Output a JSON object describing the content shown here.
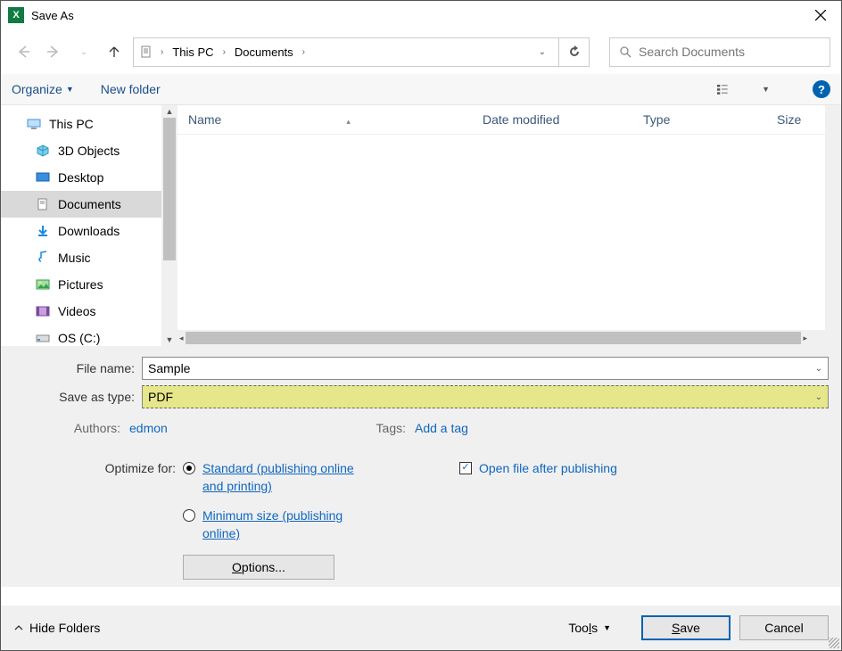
{
  "title": "Save As",
  "path": {
    "segments": [
      "This PC",
      "Documents"
    ]
  },
  "search": {
    "placeholder": "Search Documents"
  },
  "toolbar": {
    "organize": "Organize",
    "new_folder": "New folder"
  },
  "tree": {
    "items": [
      {
        "label": "This PC",
        "icon": "pc"
      },
      {
        "label": "3D Objects",
        "icon": "3d"
      },
      {
        "label": "Desktop",
        "icon": "desktop"
      },
      {
        "label": "Documents",
        "icon": "documents",
        "selected": true
      },
      {
        "label": "Downloads",
        "icon": "downloads"
      },
      {
        "label": "Music",
        "icon": "music"
      },
      {
        "label": "Pictures",
        "icon": "pictures"
      },
      {
        "label": "Videos",
        "icon": "videos"
      },
      {
        "label": "OS (C:)",
        "icon": "disk"
      }
    ]
  },
  "columns": {
    "name": "Name",
    "date": "Date modified",
    "type": "Type",
    "size": "Size"
  },
  "fields": {
    "filename_label": "File name:",
    "filename_value": "Sample",
    "savetype_label": "Save as type:",
    "savetype_value": "PDF",
    "authors_label": "Authors:",
    "authors_value": "edmon",
    "tags_label": "Tags:",
    "tags_value": "Add a tag"
  },
  "optimize": {
    "label": "Optimize for:",
    "standard": "Standard (publishing online and printing)",
    "minimum": "Minimum size (publishing online)",
    "selected": "standard"
  },
  "open_after": {
    "label": "Open file after publishing",
    "checked": true
  },
  "options_btn": "Options...",
  "footer": {
    "hide_folders": "Hide Folders",
    "tools": "Tools",
    "save": "Save",
    "cancel": "Cancel"
  }
}
